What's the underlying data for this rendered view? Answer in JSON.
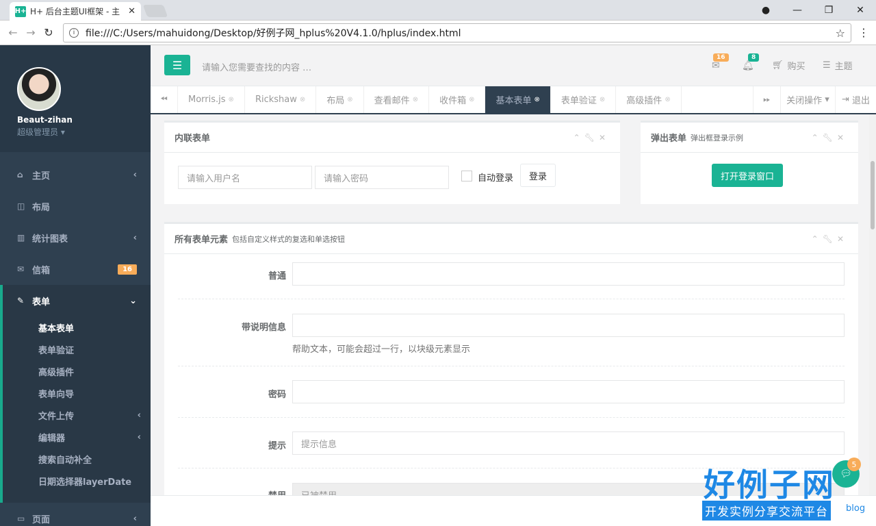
{
  "browser": {
    "tab_title": "H+ 后台主题UI框架 - 主",
    "favicon": "H+",
    "tab_close": "✕",
    "url": "file:///C:/Users/mahuidong/Desktop/好例子网_hplus%20V4.1.0/hplus/index.html"
  },
  "sidebar": {
    "user_name": "Beaut-zihan",
    "user_role": "超级管理员",
    "items": [
      {
        "icon": "home-icon",
        "glyph": "⌂",
        "label": "主页",
        "arrow": "‹"
      },
      {
        "icon": "columns-icon",
        "glyph": "◫",
        "label": "布局",
        "arrow": ""
      },
      {
        "icon": "bar-chart-icon",
        "glyph": "▥",
        "label": "统计图表",
        "arrow": "‹"
      },
      {
        "icon": "envelope-icon",
        "glyph": "✉",
        "label": "信箱",
        "badge": "16"
      },
      {
        "icon": "edit-icon",
        "glyph": "✎",
        "label": "表单",
        "arrow": "⌄"
      }
    ],
    "sub_items": [
      {
        "label": "基本表单",
        "arrow": ""
      },
      {
        "label": "表单验证",
        "arrow": ""
      },
      {
        "label": "高级插件",
        "arrow": ""
      },
      {
        "label": "表单向导",
        "arrow": ""
      },
      {
        "label": "文件上传",
        "arrow": "‹"
      },
      {
        "label": "编辑器",
        "arrow": "‹"
      },
      {
        "label": "搜索自动补全",
        "arrow": ""
      },
      {
        "label": "日期选择器layerDate",
        "arrow": ""
      }
    ],
    "page_item": {
      "label": "页面",
      "arrow": "‹"
    }
  },
  "header": {
    "search_placeholder": "请输入您需要查找的内容 …",
    "mail_badge": "16",
    "bell_badge": "8",
    "buy_label": "购买",
    "theme_label": "主题"
  },
  "tabs": {
    "items": [
      "Morris.js",
      "Rickshaw",
      "布局",
      "查看邮件",
      "收件箱",
      "基本表单",
      "表单验证",
      "高级插件"
    ],
    "close_ops": "关闭操作",
    "logout": "退出"
  },
  "inline_form": {
    "title": "内联表单",
    "username_placeholder": "请输入用户名",
    "password_placeholder": "请输入密码",
    "remember_label": "自动登录",
    "login_button": "登录"
  },
  "modal_form": {
    "title": "弹出表单",
    "subtitle": "弹出框登录示例",
    "open_button": "打开登录窗口"
  },
  "all_elements": {
    "title": "所有表单元素",
    "subtitle": "包括自定义样式的复选和单选按钮",
    "fields": [
      {
        "label": "普通",
        "placeholder": "",
        "help": ""
      },
      {
        "label": "带说明信息",
        "placeholder": "",
        "help": "帮助文本，可能会超过一行，以块级元素显示"
      },
      {
        "label": "密码",
        "placeholder": "",
        "help": ""
      },
      {
        "label": "提示",
        "placeholder": "提示信息",
        "help": ""
      },
      {
        "label": "禁用",
        "placeholder": "已被禁用",
        "help": ""
      }
    ]
  },
  "overlay": {
    "chat_badge": "5",
    "logo_title": "好例子网",
    "logo_subtitle": "开发实例分享交流平台",
    "blog_text": "blog"
  },
  "colors": {
    "accent": "#1ab394",
    "sidebar": "#2f4050",
    "badge": "#f8ac59"
  }
}
